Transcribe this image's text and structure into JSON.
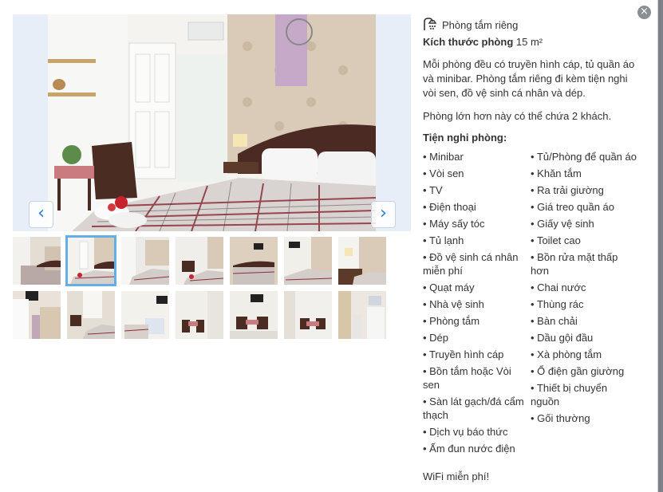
{
  "close_label": "×",
  "gallery": {
    "prev_label": "‹",
    "next_label": "›",
    "thumbnail_count": 14,
    "selected_index": 1
  },
  "room": {
    "bathroom": "Phòng tắm riêng",
    "size_label": "Kích thước phòng",
    "size_value": "15 m²",
    "description": "Mỗi phòng đều có truyền hình cáp, tủ quần áo và minibar. Phòng tắm riêng đi kèm tiện nghi vòi sen, đồ vệ sinh cá nhân và dép.",
    "capacity": "Phòng lớn hơn này có thể chứa 2 khách.",
    "amenities_title": "Tiện nghi phòng:",
    "amenities_left": [
      "Minibar",
      "Vòi sen",
      "TV",
      "Điện thoại",
      "Máy sấy tóc",
      "Tủ lạnh",
      "Đồ vệ sinh cá nhân miễn phí",
      "Quạt máy",
      "Nhà vệ sinh",
      "Phòng tắm",
      "Dép",
      "Truyền hình cáp",
      "Bồn tắm hoặc Vòi sen",
      "Sàn lát gạch/đá cẩm thạch",
      "Dịch vụ báo thức",
      "Ấm đun nước điện"
    ],
    "amenities_right": [
      "Tủ/Phòng để quần áo",
      "Khăn tắm",
      "Ra trải giường",
      "Giá treo quần áo",
      "Giấy vệ sinh",
      "Toilet cao",
      "Bồn rửa mặt thấp hơn",
      "Chai nước",
      "Thùng rác",
      "Bàn chải",
      "Dầu gội đầu",
      "Xà phòng tắm",
      "Ổ điện gần giường",
      "Thiết bị chuyển nguồn",
      "Gối thường"
    ],
    "wifi": "WiFi miễn phí!"
  },
  "colors": {
    "accent": "#2a7ad8",
    "selected_outline": "#64aee8",
    "text": "#333333"
  }
}
